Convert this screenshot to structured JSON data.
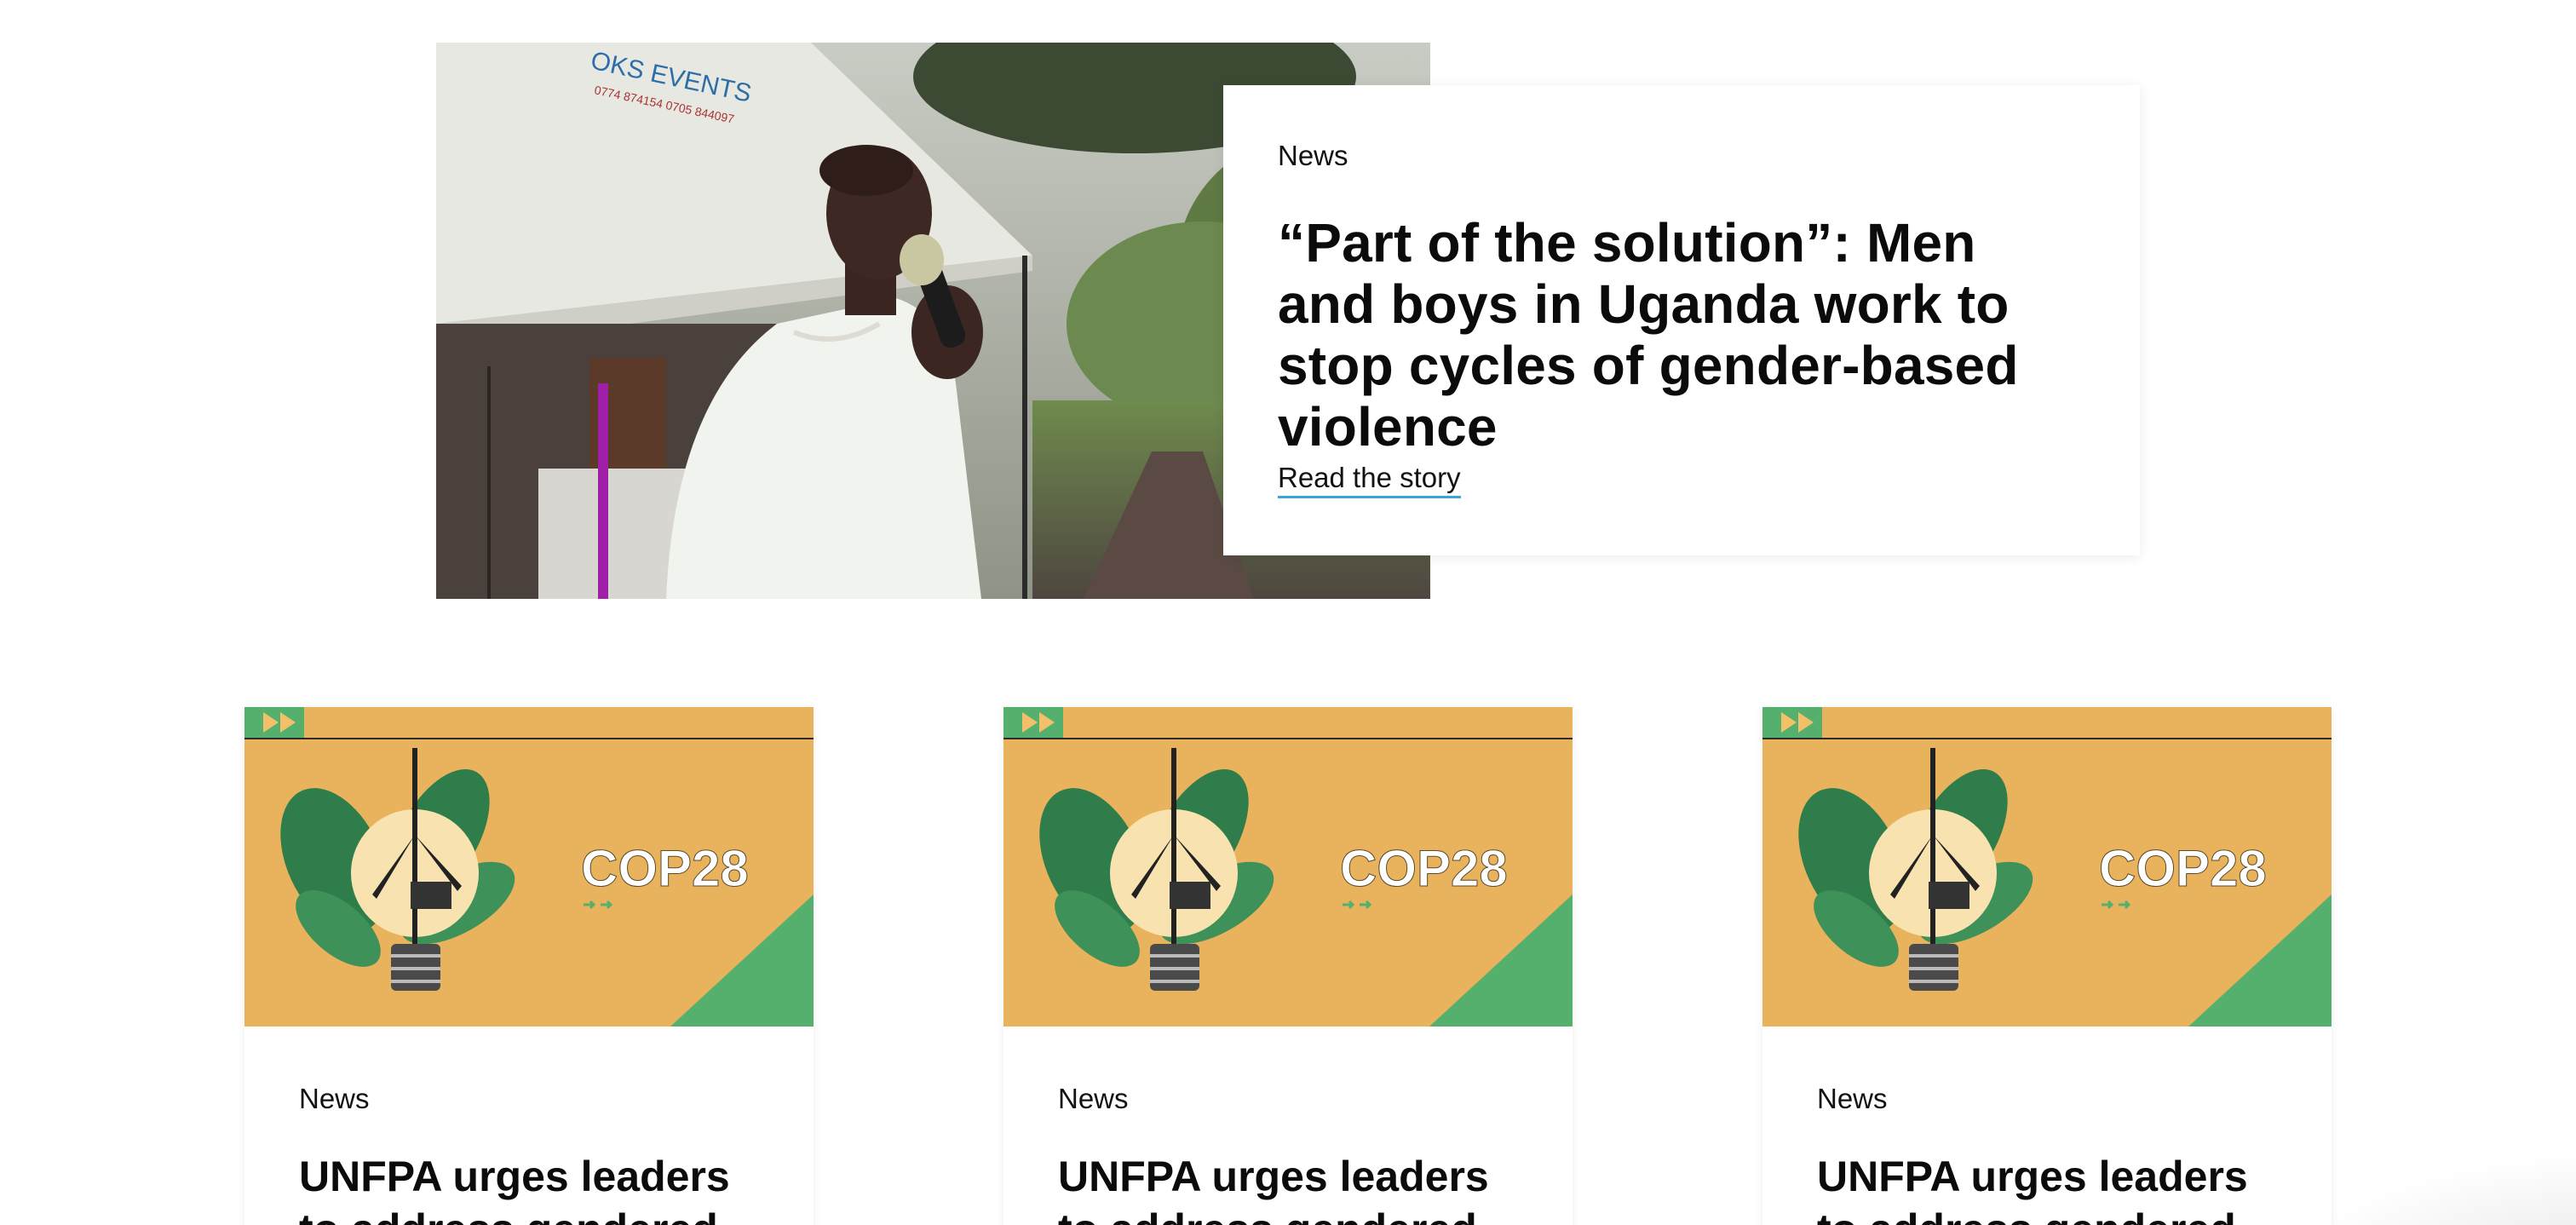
{
  "feature": {
    "tag": "News",
    "title": "“Part of the solution”: Men and boys in Uganda work to stop cycles of gender-based violence",
    "cta": "Read the story",
    "photo_alt": "Man in white robe speaking into a microphone beside a tent",
    "tent_text": "OKS EVENTS",
    "tent_phone": "0774 874154  0705 844097"
  },
  "cards": [
    {
      "tag": "News",
      "title": "UNFPA urges leaders to address gendered",
      "banner": "COP28"
    },
    {
      "tag": "News",
      "title": "UNFPA urges leaders to address gendered",
      "banner": "COP28"
    },
    {
      "tag": "News",
      "title": "UNFPA urges leaders to address gendered",
      "banner": "COP28"
    }
  ],
  "colors": {
    "banner_bg": "#e9b25c",
    "banner_green": "#55b06e",
    "link_underline": "#3aa6dd"
  }
}
